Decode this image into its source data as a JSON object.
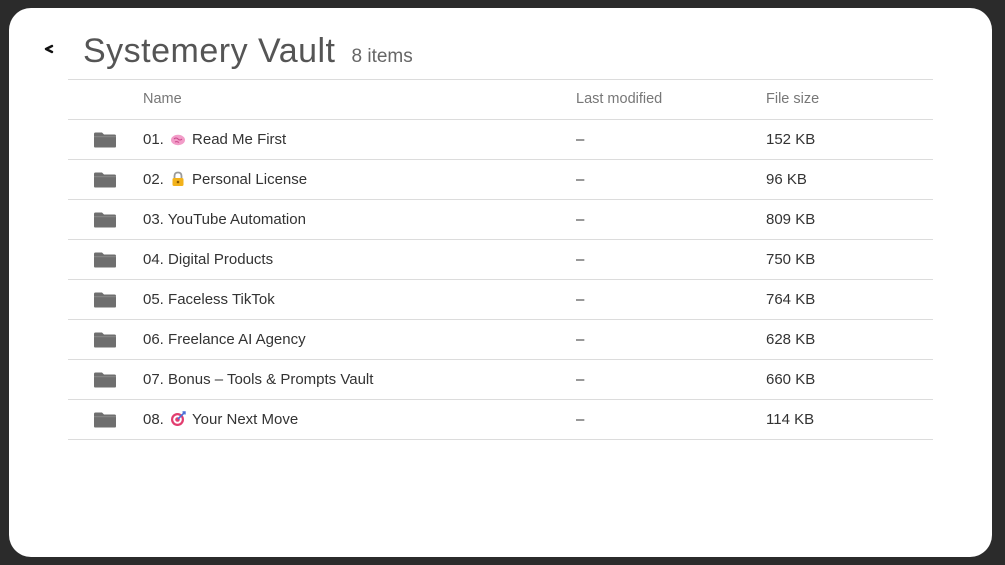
{
  "header": {
    "title": "Systemery Vault",
    "count": "8 items"
  },
  "columns": {
    "name": "Name",
    "modified": "Last modified",
    "size": "File size"
  },
  "rows": [
    {
      "prefix": "01.",
      "icon": "brain-icon",
      "label": "Read Me First",
      "modified": "–",
      "size": "152 KB"
    },
    {
      "prefix": "02.",
      "icon": "lock-icon",
      "label": "Personal License",
      "modified": "–",
      "size": "96 KB"
    },
    {
      "prefix": "03.",
      "icon": "",
      "label": "YouTube Automation",
      "modified": "–",
      "size": "809 KB"
    },
    {
      "prefix": "04.",
      "icon": "",
      "label": "Digital Products",
      "modified": "–",
      "size": "750 KB"
    },
    {
      "prefix": "05.",
      "icon": "",
      "label": "Faceless TikTok",
      "modified": "–",
      "size": "764 KB"
    },
    {
      "prefix": "06.",
      "icon": "",
      "label": "Freelance AI Agency",
      "modified": "–",
      "size": "628 KB"
    },
    {
      "prefix": "07.",
      "icon": "",
      "label": "Bonus – Tools & Prompts Vault",
      "modified": "–",
      "size": "660 KB"
    },
    {
      "prefix": "08.",
      "icon": "target-icon",
      "label": "Your Next Move",
      "modified": "–",
      "size": "114 KB"
    }
  ],
  "colors": {
    "folder": "#6f6f6f",
    "divider": "#dcdcdc",
    "title": "#555555"
  }
}
